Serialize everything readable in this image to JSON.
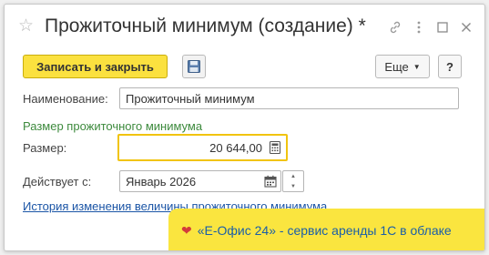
{
  "window": {
    "title": "Прожиточный минимум (создание) *"
  },
  "icons": {
    "favorite": "star-icon",
    "link": "link-icon",
    "more": "more-icon",
    "maximize": "maximize-icon",
    "close": "close-icon",
    "save": "floppy-disk-icon",
    "calculator": "calculator-icon",
    "calendar": "calendar-icon"
  },
  "toolbar": {
    "write_close_label": "Записать и закрыть",
    "more_label": "Еще",
    "help_label": "?"
  },
  "form": {
    "name_label": "Наименование:",
    "name_value": "Прожиточный минимум",
    "group_title": "Размер прожиточного минимума",
    "size_label": "Размер:",
    "size_value": "20 644,00",
    "effective_label": "Действует с:",
    "effective_value": "Январь 2026",
    "history_link": "История изменения величины прожиточного минимума"
  },
  "banner": {
    "text": "«Е-Офис 24» - сервис аренды 1С в облаке"
  },
  "colors": {
    "accent_yellow": "#fbe13f",
    "group_green": "#3d8a3d",
    "link_blue": "#1b55a6",
    "focus_border": "#f1c40f"
  }
}
